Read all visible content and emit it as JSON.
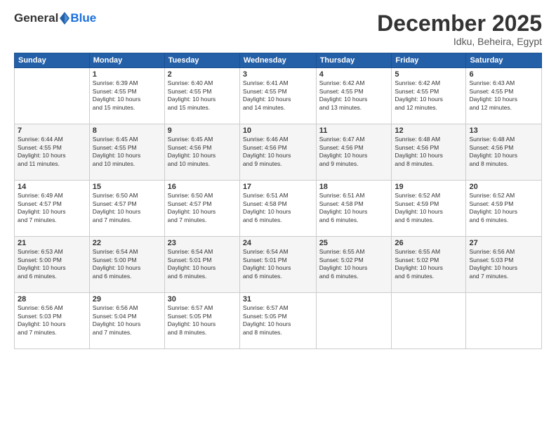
{
  "logo": {
    "general": "General",
    "blue": "Blue"
  },
  "header": {
    "month": "December 2025",
    "location": "Idku, Beheira, Egypt"
  },
  "days_of_week": [
    "Sunday",
    "Monday",
    "Tuesday",
    "Wednesday",
    "Thursday",
    "Friday",
    "Saturday"
  ],
  "weeks": [
    [
      {
        "day": "",
        "info": ""
      },
      {
        "day": "1",
        "info": "Sunrise: 6:39 AM\nSunset: 4:55 PM\nDaylight: 10 hours\nand 15 minutes."
      },
      {
        "day": "2",
        "info": "Sunrise: 6:40 AM\nSunset: 4:55 PM\nDaylight: 10 hours\nand 15 minutes."
      },
      {
        "day": "3",
        "info": "Sunrise: 6:41 AM\nSunset: 4:55 PM\nDaylight: 10 hours\nand 14 minutes."
      },
      {
        "day": "4",
        "info": "Sunrise: 6:42 AM\nSunset: 4:55 PM\nDaylight: 10 hours\nand 13 minutes."
      },
      {
        "day": "5",
        "info": "Sunrise: 6:42 AM\nSunset: 4:55 PM\nDaylight: 10 hours\nand 12 minutes."
      },
      {
        "day": "6",
        "info": "Sunrise: 6:43 AM\nSunset: 4:55 PM\nDaylight: 10 hours\nand 12 minutes."
      }
    ],
    [
      {
        "day": "7",
        "info": "Sunrise: 6:44 AM\nSunset: 4:55 PM\nDaylight: 10 hours\nand 11 minutes."
      },
      {
        "day": "8",
        "info": "Sunrise: 6:45 AM\nSunset: 4:55 PM\nDaylight: 10 hours\nand 10 minutes."
      },
      {
        "day": "9",
        "info": "Sunrise: 6:45 AM\nSunset: 4:56 PM\nDaylight: 10 hours\nand 10 minutes."
      },
      {
        "day": "10",
        "info": "Sunrise: 6:46 AM\nSunset: 4:56 PM\nDaylight: 10 hours\nand 9 minutes."
      },
      {
        "day": "11",
        "info": "Sunrise: 6:47 AM\nSunset: 4:56 PM\nDaylight: 10 hours\nand 9 minutes."
      },
      {
        "day": "12",
        "info": "Sunrise: 6:48 AM\nSunset: 4:56 PM\nDaylight: 10 hours\nand 8 minutes."
      },
      {
        "day": "13",
        "info": "Sunrise: 6:48 AM\nSunset: 4:56 PM\nDaylight: 10 hours\nand 8 minutes."
      }
    ],
    [
      {
        "day": "14",
        "info": "Sunrise: 6:49 AM\nSunset: 4:57 PM\nDaylight: 10 hours\nand 7 minutes."
      },
      {
        "day": "15",
        "info": "Sunrise: 6:50 AM\nSunset: 4:57 PM\nDaylight: 10 hours\nand 7 minutes."
      },
      {
        "day": "16",
        "info": "Sunrise: 6:50 AM\nSunset: 4:57 PM\nDaylight: 10 hours\nand 7 minutes."
      },
      {
        "day": "17",
        "info": "Sunrise: 6:51 AM\nSunset: 4:58 PM\nDaylight: 10 hours\nand 6 minutes."
      },
      {
        "day": "18",
        "info": "Sunrise: 6:51 AM\nSunset: 4:58 PM\nDaylight: 10 hours\nand 6 minutes."
      },
      {
        "day": "19",
        "info": "Sunrise: 6:52 AM\nSunset: 4:59 PM\nDaylight: 10 hours\nand 6 minutes."
      },
      {
        "day": "20",
        "info": "Sunrise: 6:52 AM\nSunset: 4:59 PM\nDaylight: 10 hours\nand 6 minutes."
      }
    ],
    [
      {
        "day": "21",
        "info": "Sunrise: 6:53 AM\nSunset: 5:00 PM\nDaylight: 10 hours\nand 6 minutes."
      },
      {
        "day": "22",
        "info": "Sunrise: 6:54 AM\nSunset: 5:00 PM\nDaylight: 10 hours\nand 6 minutes."
      },
      {
        "day": "23",
        "info": "Sunrise: 6:54 AM\nSunset: 5:01 PM\nDaylight: 10 hours\nand 6 minutes."
      },
      {
        "day": "24",
        "info": "Sunrise: 6:54 AM\nSunset: 5:01 PM\nDaylight: 10 hours\nand 6 minutes."
      },
      {
        "day": "25",
        "info": "Sunrise: 6:55 AM\nSunset: 5:02 PM\nDaylight: 10 hours\nand 6 minutes."
      },
      {
        "day": "26",
        "info": "Sunrise: 6:55 AM\nSunset: 5:02 PM\nDaylight: 10 hours\nand 6 minutes."
      },
      {
        "day": "27",
        "info": "Sunrise: 6:56 AM\nSunset: 5:03 PM\nDaylight: 10 hours\nand 7 minutes."
      }
    ],
    [
      {
        "day": "28",
        "info": "Sunrise: 6:56 AM\nSunset: 5:03 PM\nDaylight: 10 hours\nand 7 minutes."
      },
      {
        "day": "29",
        "info": "Sunrise: 6:56 AM\nSunset: 5:04 PM\nDaylight: 10 hours\nand 7 minutes."
      },
      {
        "day": "30",
        "info": "Sunrise: 6:57 AM\nSunset: 5:05 PM\nDaylight: 10 hours\nand 8 minutes."
      },
      {
        "day": "31",
        "info": "Sunrise: 6:57 AM\nSunset: 5:05 PM\nDaylight: 10 hours\nand 8 minutes."
      },
      {
        "day": "",
        "info": ""
      },
      {
        "day": "",
        "info": ""
      },
      {
        "day": "",
        "info": ""
      }
    ]
  ]
}
